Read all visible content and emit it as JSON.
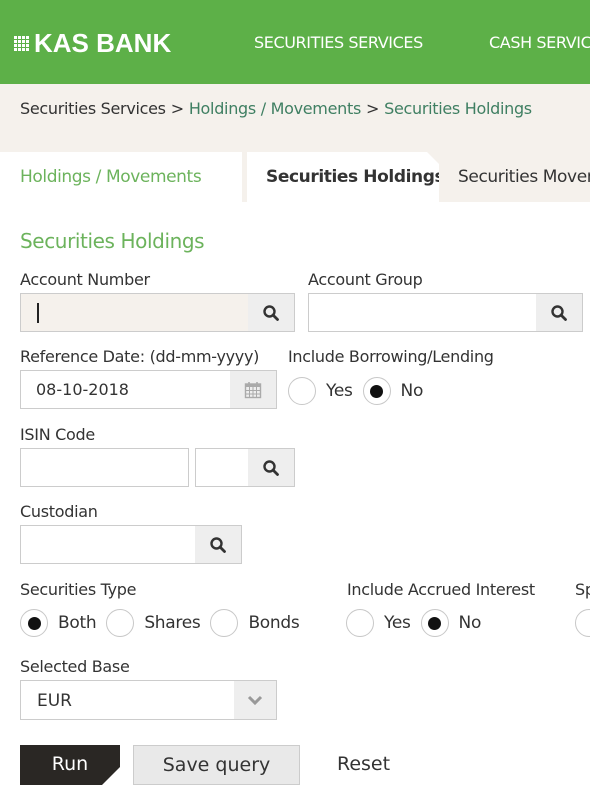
{
  "header": {
    "logo_text": "KAS BANK",
    "brand_color": "#5db048",
    "nav": [
      "SECURITIES SERVICES",
      "CASH SERVICES"
    ]
  },
  "breadcrumb": {
    "root": "Securities Services",
    "separator": ">",
    "items": [
      "Holdings / Movements",
      "Securities Holdings"
    ]
  },
  "tabs": [
    {
      "label": "Holdings / Movements",
      "active": false
    },
    {
      "label": "Securities Holdings",
      "active": true
    },
    {
      "label": "Securities Movements",
      "active": false
    }
  ],
  "form": {
    "title": "Securities Holdings",
    "account_number": {
      "label": "Account Number",
      "value": ""
    },
    "account_group": {
      "label": "Account Group",
      "value": ""
    },
    "reference_date": {
      "label": "Reference Date: (dd-mm-yyyy)",
      "value": "08-10-2018"
    },
    "borrowing_lending": {
      "label": "Include Borrowing/Lending",
      "options": [
        "Yes",
        "No"
      ],
      "selected": "No"
    },
    "isin_code": {
      "label": "ISIN Code",
      "value": "",
      "value2": ""
    },
    "custodian": {
      "label": "Custodian",
      "value": ""
    },
    "securities_type": {
      "label": "Securities Type",
      "options": [
        "Both",
        "Shares",
        "Bonds"
      ],
      "selected": "Both"
    },
    "accrued_interest": {
      "label": "Include Accrued Interest",
      "options": [
        "Yes",
        "No"
      ],
      "selected": "No"
    },
    "truncated_label": "Sp",
    "selected_base": {
      "label": "Selected Base",
      "value": "EUR"
    }
  },
  "actions": {
    "run": "Run",
    "save_query": "Save query",
    "reset": "Reset"
  }
}
